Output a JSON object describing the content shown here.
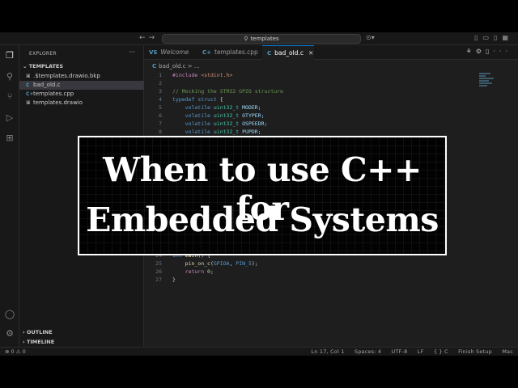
{
  "titlebar": {
    "search_text": "templates"
  },
  "sidebar": {
    "header": "EXPLORER",
    "folder": "TEMPLATES",
    "files": [
      {
        "name": ".$templates.drawio.bkp",
        "icon": "drawio-file-icon"
      },
      {
        "name": "bad_old.c",
        "icon": "c-file-icon",
        "badge": "C"
      },
      {
        "name": "templates.cpp",
        "icon": "cpp-file-icon",
        "badge": "C+"
      },
      {
        "name": "templates.drawio",
        "icon": "drawio-file-icon"
      }
    ],
    "sections": [
      "OUTLINE",
      "TIMELINE"
    ]
  },
  "tabs": [
    {
      "label": "Welcome",
      "badge": "VS"
    },
    {
      "label": "templates.cpp",
      "badge": "C+"
    },
    {
      "label": "bad_old.c",
      "badge": "C",
      "active": true
    }
  ],
  "breadcrumb": {
    "file": "bad_old.c",
    "rest": "> ..."
  },
  "code": {
    "l1": "1",
    "l1a": "#include",
    "l1b": " <stdint.h>",
    "l2": "2",
    "l3": "3",
    "l3a": "// Mocking the STM32 GPIO structure",
    "l4": "4",
    "l4a": "typedef",
    "l4b": " struct",
    "l4c": " {",
    "l5": "5",
    "l5a": "volatile",
    "l5b": " uint32_t",
    "l5c": " MODER;",
    "l6": "6",
    "l6a": "volatile",
    "l6b": " uint32_t",
    "l6c": " OTYPER;",
    "l7": "7",
    "l7a": "volatile",
    "l7b": " uint32_t",
    "l7c": " OSPEEDR;",
    "l8": "8",
    "l8a": "volatile",
    "l8b": " uint32_t",
    "l8c": " PUPDR;",
    "l24": "24",
    "l24a": "int",
    "l24b": " main",
    "l24c": "() {",
    "l25": "25",
    "l25a": "pin_on_c",
    "l25b": "(",
    "l25c": "GPIOA",
    "l25d": ", ",
    "l25e": "PIN_5",
    "l25f": ");",
    "l26": "26",
    "l26a": "return",
    "l26b": " 0",
    "l26c": ";",
    "l27": "27",
    "l27a": "}"
  },
  "statusbar": {
    "left": "⊗ 0 ⚠ 0",
    "position": "Ln 17, Col 1",
    "spaces": "Spaces: 4",
    "encoding": "UTF-8",
    "eol": "LF",
    "lang": "{ } C",
    "finish": "Finish Setup",
    "mac": "Mac"
  },
  "overlay": {
    "line1": "When to use C++ for",
    "line2": "Embedded Systems"
  }
}
